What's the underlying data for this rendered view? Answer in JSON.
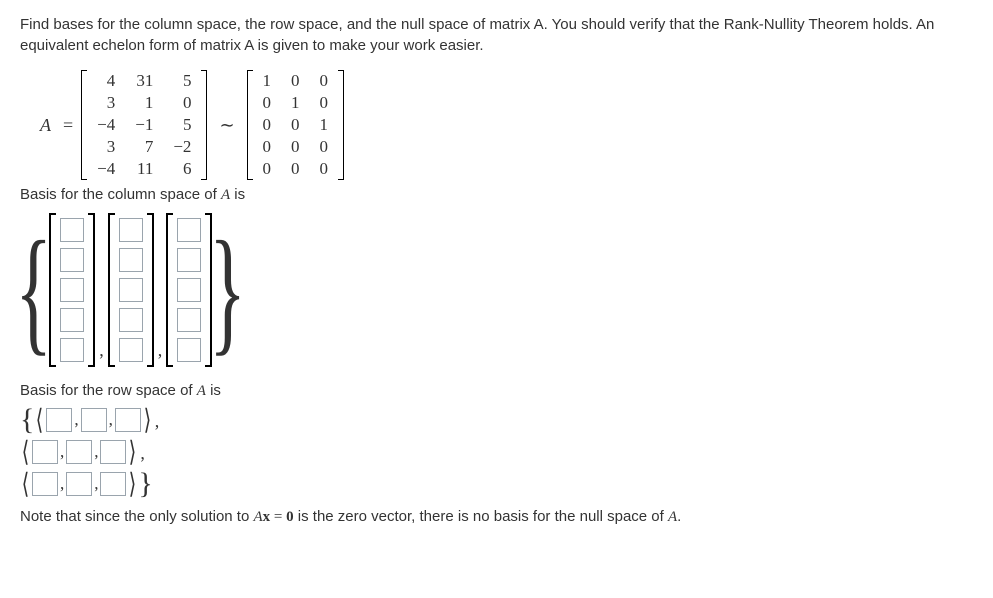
{
  "instructions": "Find bases for the column space, the row space, and the null space of matrix A. You should verify that the Rank-Nullity Theorem holds. An equivalent echelon form of matrix A is given to make your work easier.",
  "matrix_lhs": "A",
  "equals": "=",
  "tilde": "∼",
  "matrixA": [
    [
      "4",
      "31",
      "5"
    ],
    [
      "3",
      "1",
      "0"
    ],
    [
      "−4",
      "−1",
      "5"
    ],
    [
      "3",
      "7",
      "−2"
    ],
    [
      "−4",
      "11",
      "6"
    ]
  ],
  "matrixE": [
    [
      "1",
      "0",
      "0"
    ],
    [
      "0",
      "1",
      "0"
    ],
    [
      "0",
      "0",
      "1"
    ],
    [
      "0",
      "0",
      "0"
    ],
    [
      "0",
      "0",
      "0"
    ]
  ],
  "col_label_pre": "Basis for the column space of ",
  "col_label_var": "A",
  "col_label_post": " is",
  "row_label_pre": "Basis for the row space of ",
  "row_label_var": "A",
  "row_label_post": " is",
  "note_p1": "Note that since the only solution to ",
  "note_eq_A": "A",
  "note_eq_x": "x",
  "note_eq_eq": " = ",
  "note_eq_0": "0",
  "note_p2": " is the zero vector, there is no basis for the null space of ",
  "note_var": "A",
  "note_p3": ".",
  "colspace": {
    "vectors": 3,
    "dim": 5
  },
  "rowspace": {
    "vectors": 3,
    "dim": 3
  }
}
